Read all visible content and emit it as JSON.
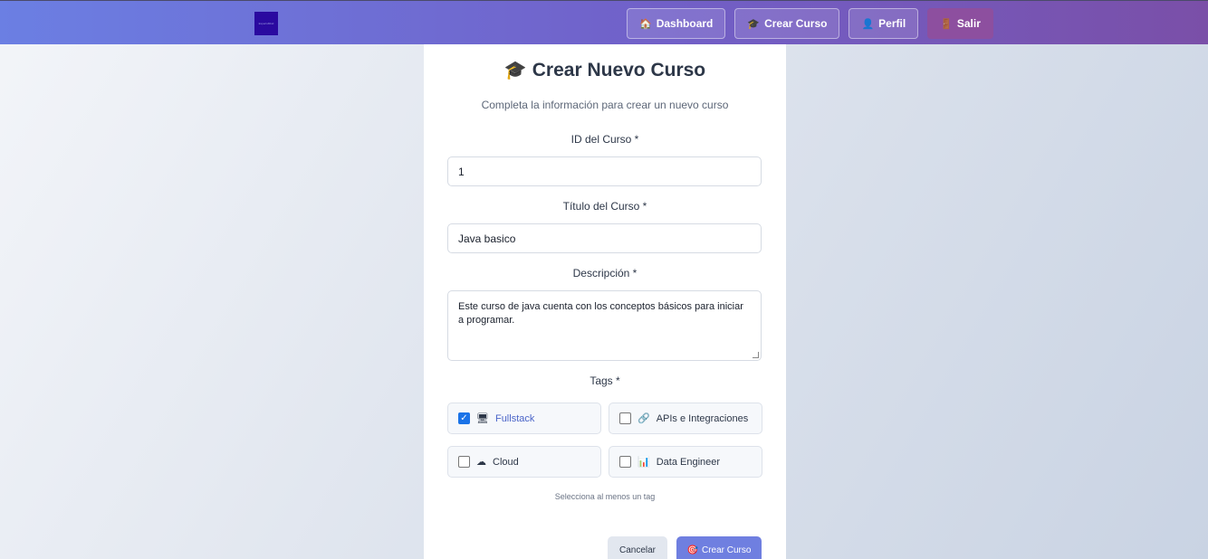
{
  "header": {
    "logo_text": "ExpertsMind",
    "nav": [
      {
        "icon": "house-icon",
        "glyph": "🏠",
        "label": "Dashboard"
      },
      {
        "icon": "graduation-cap-icon",
        "glyph": "🎓",
        "label": "Crear Curso"
      },
      {
        "icon": "person-icon",
        "glyph": "👤",
        "label": "Perfil"
      },
      {
        "icon": "door-icon",
        "glyph": "🚪",
        "label": "Salir"
      }
    ]
  },
  "form": {
    "title_icon": "🎓",
    "title": "Crear Nuevo Curso",
    "subtitle": "Completa la información para crear un nuevo curso",
    "id_label": "ID del Curso *",
    "id_value": "1",
    "title_label": "Título del Curso *",
    "title_value": "Java basico",
    "description_label": "Descripción *",
    "description_value": "Este curso de java cuenta con los conceptos básicos para iniciar a programar.",
    "tags_label": "Tags *",
    "tags": [
      {
        "icon": "monitor-icon",
        "glyph": "🖥",
        "label": "Fullstack",
        "checked": true
      },
      {
        "icon": "link-icon",
        "glyph": "🔗",
        "label": "APIs e Integraciones",
        "checked": false
      },
      {
        "icon": "cloud-icon",
        "glyph": "☁",
        "label": "Cloud",
        "checked": false
      },
      {
        "icon": "bar-chart-icon",
        "glyph": "📊",
        "label": "Data Engineer",
        "checked": false
      }
    ],
    "tags_hint": "Selecciona al menos un tag",
    "cancel_label": "Cancelar",
    "submit_icon": "🎯",
    "submit_label": "Crear Curso"
  },
  "colors": {
    "accent": "#6f7fe0",
    "header_start": "#6b7fe3",
    "header_end": "#7a4fa8",
    "checkbox": "#1a73e8"
  }
}
